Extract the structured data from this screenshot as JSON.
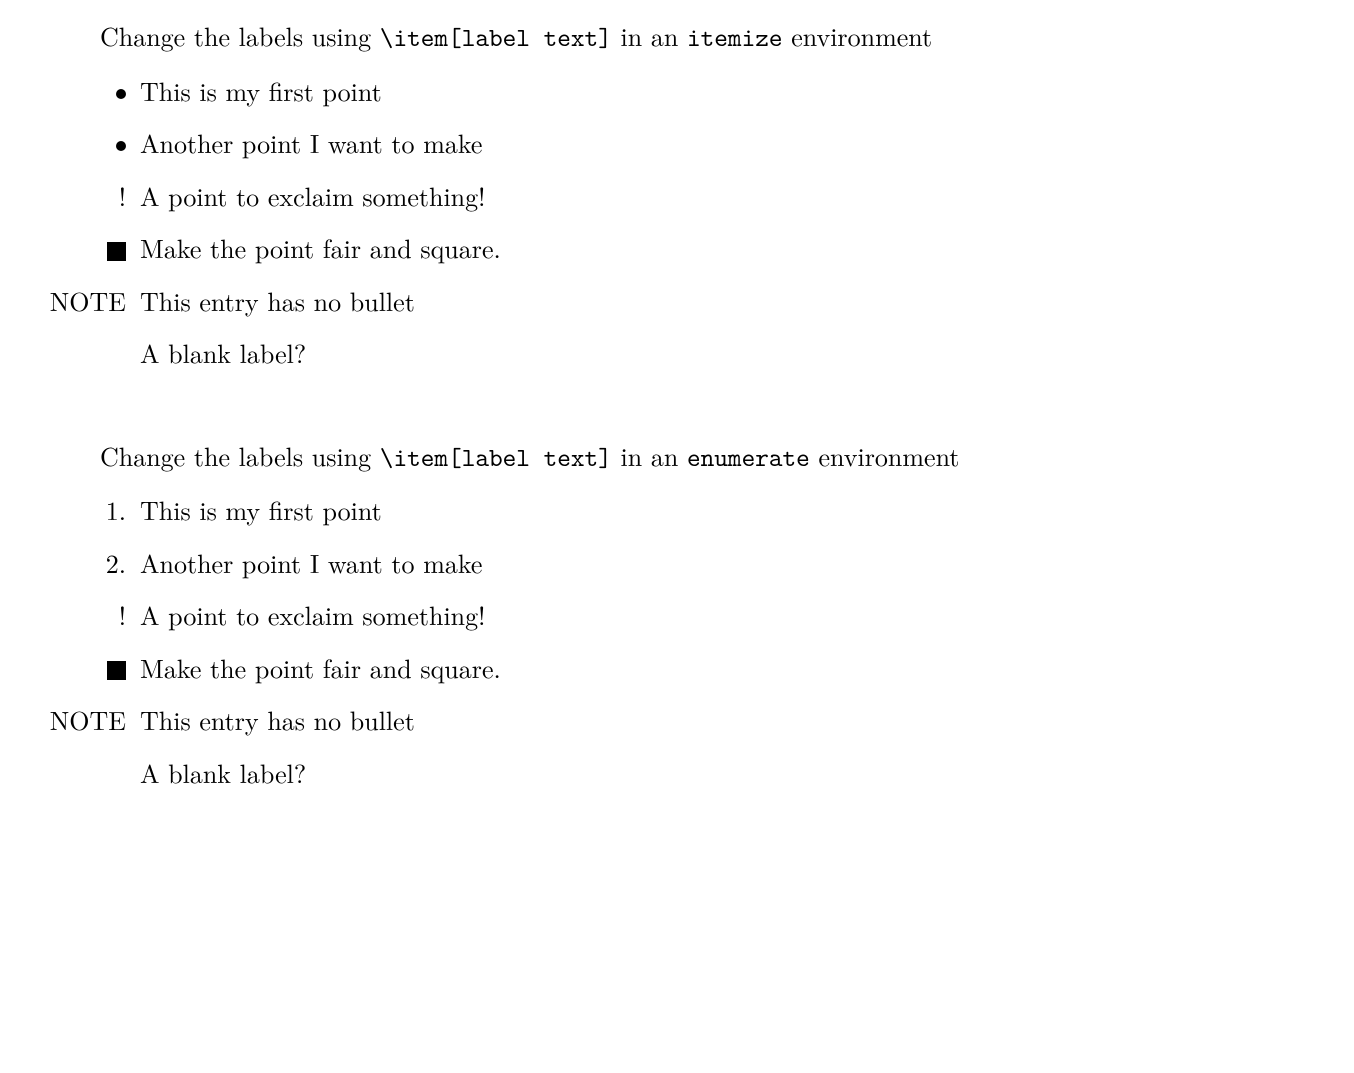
{
  "section1": {
    "intro_pre": "Change the labels using ",
    "intro_code": "\\item[label text]",
    "intro_mid": " in an ",
    "intro_env": "itemize",
    "intro_post": " environment",
    "items": [
      {
        "label_type": "dot",
        "label_text": "",
        "text": "This is my first point"
      },
      {
        "label_type": "dot",
        "label_text": "",
        "text": "Another point I want to make"
      },
      {
        "label_type": "text",
        "label_text": "!",
        "text": "A point to exclaim something!"
      },
      {
        "label_type": "square",
        "label_text": "",
        "text": "Make the point fair and square."
      },
      {
        "label_type": "text",
        "label_text": "NOTE",
        "text": "This entry has no bullet"
      },
      {
        "label_type": "text",
        "label_text": "",
        "text": "A blank label?"
      }
    ]
  },
  "section2": {
    "intro_pre": "Change the labels using ",
    "intro_code": "\\item[label text]",
    "intro_mid": " in an ",
    "intro_env": "enumerate",
    "intro_post": " environment",
    "items": [
      {
        "label_type": "text",
        "label_text": "1.",
        "text": "This is my first point"
      },
      {
        "label_type": "text",
        "label_text": "2.",
        "text": "Another point I want to make"
      },
      {
        "label_type": "text",
        "label_text": "!",
        "text": "A point to exclaim something!"
      },
      {
        "label_type": "square",
        "label_text": "",
        "text": "Make the point fair and square."
      },
      {
        "label_type": "text",
        "label_text": "NOTE",
        "text": "This entry has no bullet"
      },
      {
        "label_type": "text",
        "label_text": "",
        "text": "A blank label?"
      }
    ]
  }
}
